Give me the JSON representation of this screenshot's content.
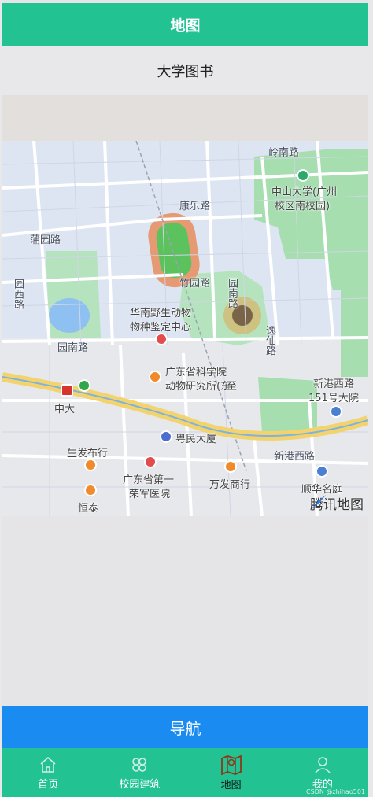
{
  "header": {
    "title": "地图"
  },
  "subtitle": "大学图书",
  "map": {
    "roads": [
      "岭南路",
      "康乐路",
      "蒲园路",
      "园西路",
      "竹园路",
      "园南路",
      "园南路",
      "逸仙路",
      "新港西路"
    ],
    "campus_label": "中山大学(广州\n校区南校园)",
    "campus_label_line1": "中山大学(广州",
    "campus_label_line2": "校区南校园)",
    "pois": {
      "wildlife_line1": "华南野生动物",
      "wildlife_line2": "物种鉴定中心",
      "zoology_line1": "广东省科学院",
      "zoology_line2": "动物研究所(东",
      "zoology_line2b": "至",
      "xingang_line1": "新港西路",
      "xingang_line2": "151号大院",
      "metro": "中大",
      "yuemin": "粤民大厦",
      "shengfa": "生发布行",
      "hospital_line1": "广东省第一",
      "hospital_line2": "荣军医院",
      "wanfa": "万发商行",
      "hengtai": "恒泰",
      "shunhua": "顺华名庭"
    },
    "brand": "腾讯地图"
  },
  "navigate_button": "导航",
  "tabs": [
    {
      "label": "首页",
      "icon": "home-icon"
    },
    {
      "label": "校园建筑",
      "icon": "buildings-icon"
    },
    {
      "label": "地图",
      "icon": "map-icon"
    },
    {
      "label": "我的",
      "icon": "user-icon"
    }
  ],
  "watermark": "CSDN @zhihao501",
  "colors": {
    "header": "#22c293",
    "nav_button": "#1a8bf0",
    "tabbar": "#22c293"
  }
}
